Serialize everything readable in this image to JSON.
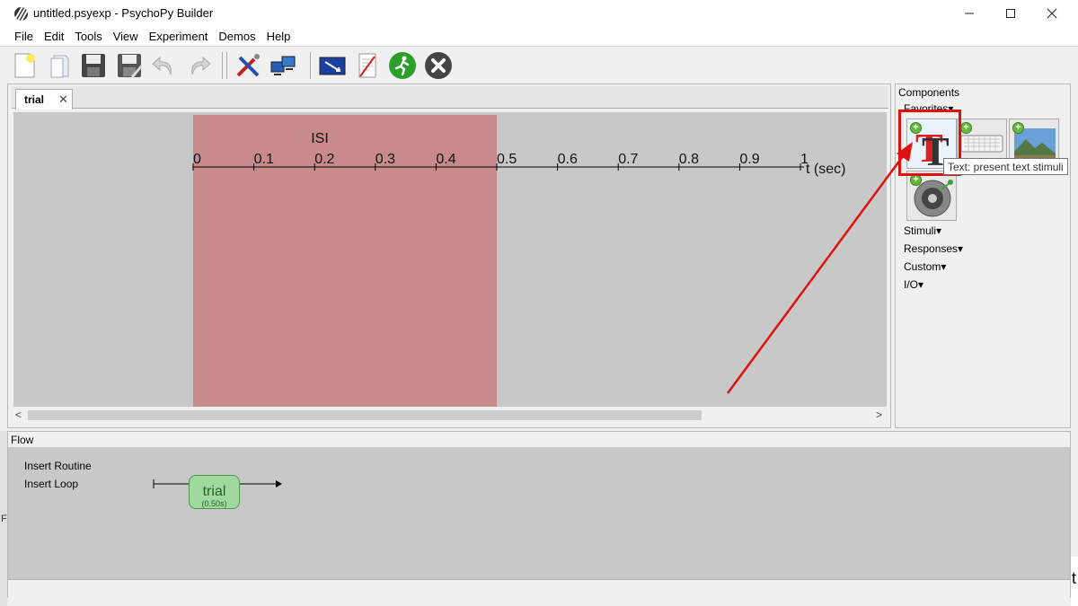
{
  "window": {
    "title": "untitled.psyexp - PsychoPy Builder"
  },
  "menu": [
    "File",
    "Edit",
    "Tools",
    "View",
    "Experiment",
    "Demos",
    "Help"
  ],
  "toolbar_icons": [
    "new-file-icon",
    "open-file-icon",
    "save-icon",
    "save-as-icon",
    "undo-icon",
    "redo-icon",
    "preferences-icon",
    "monitor-center-icon",
    "experiment-settings-icon",
    "compile-script-icon",
    "run-icon",
    "stop-icon"
  ],
  "routine": {
    "tab_label": "trial",
    "component_name": "ISI",
    "component_onset": 0,
    "component_offset": 0.5,
    "timeline": {
      "ticks": [
        "0",
        "0.1",
        "0.2",
        "0.3",
        "0.4",
        "0.5",
        "0.6",
        "0.7",
        "0.8",
        "0.9",
        "1"
      ],
      "unit_label": "t (sec)",
      "min": 0,
      "max": 1
    }
  },
  "components": {
    "title": "Components",
    "favorites_label": "Favorites",
    "favorites": [
      "text-component",
      "keyboard-component",
      "image-component",
      "sound-component"
    ],
    "tooltip": "Text: present text stimuli",
    "categories": [
      "Stimuli",
      "Responses",
      "Custom",
      "I/O"
    ]
  },
  "flow": {
    "title": "Flow",
    "insert_routine": "Insert Routine",
    "insert_loop": "Insert Loop",
    "routine_name": "trial",
    "routine_duration": "(0.50s)"
  },
  "background": {
    "left_letter": "F",
    "right_letter": "t"
  },
  "colors": {
    "isi_block": "#c88a8a",
    "highlight": "#e01010",
    "arrow": "#e01010",
    "flow_routine": "#a0d8a0"
  }
}
